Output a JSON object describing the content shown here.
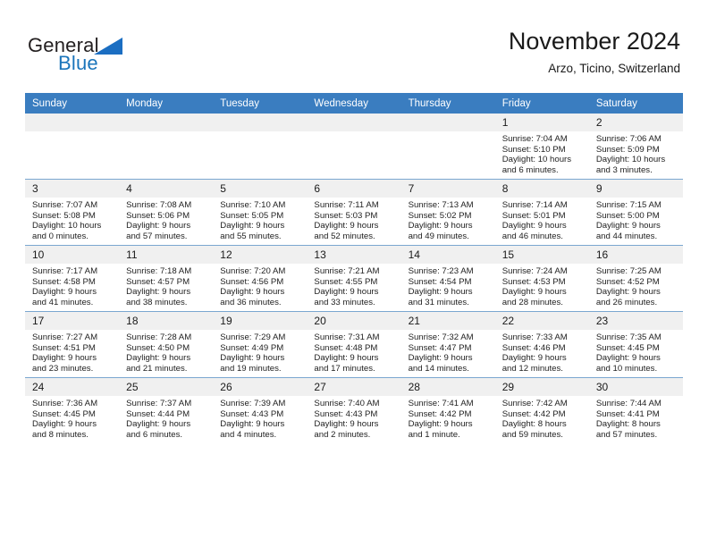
{
  "brand": {
    "text_primary": "General",
    "text_secondary": "Blue",
    "triangle_icon": "triangle-icon",
    "accent_color": "#1b6ec2"
  },
  "header": {
    "month_title": "November 2024",
    "location": "Arzo, Ticino, Switzerland"
  },
  "calendar": {
    "header_color": "#3a7dc0",
    "weekday_headers": [
      "Sunday",
      "Monday",
      "Tuesday",
      "Wednesday",
      "Thursday",
      "Friday",
      "Saturday"
    ],
    "weeks": [
      [
        {
          "day": "",
          "sunrise": "",
          "sunset": "",
          "daylight_line1": "",
          "daylight_line2": "",
          "empty": true
        },
        {
          "day": "",
          "sunrise": "",
          "sunset": "",
          "daylight_line1": "",
          "daylight_line2": "",
          "empty": true
        },
        {
          "day": "",
          "sunrise": "",
          "sunset": "",
          "daylight_line1": "",
          "daylight_line2": "",
          "empty": true
        },
        {
          "day": "",
          "sunrise": "",
          "sunset": "",
          "daylight_line1": "",
          "daylight_line2": "",
          "empty": true
        },
        {
          "day": "",
          "sunrise": "",
          "sunset": "",
          "daylight_line1": "",
          "daylight_line2": "",
          "empty": true
        },
        {
          "day": "1",
          "sunrise": "Sunrise: 7:04 AM",
          "sunset": "Sunset: 5:10 PM",
          "daylight_line1": "Daylight: 10 hours",
          "daylight_line2": "and 6 minutes.",
          "empty": false
        },
        {
          "day": "2",
          "sunrise": "Sunrise: 7:06 AM",
          "sunset": "Sunset: 5:09 PM",
          "daylight_line1": "Daylight: 10 hours",
          "daylight_line2": "and 3 minutes.",
          "empty": false
        }
      ],
      [
        {
          "day": "3",
          "sunrise": "Sunrise: 7:07 AM",
          "sunset": "Sunset: 5:08 PM",
          "daylight_line1": "Daylight: 10 hours",
          "daylight_line2": "and 0 minutes.",
          "empty": false
        },
        {
          "day": "4",
          "sunrise": "Sunrise: 7:08 AM",
          "sunset": "Sunset: 5:06 PM",
          "daylight_line1": "Daylight: 9 hours",
          "daylight_line2": "and 57 minutes.",
          "empty": false
        },
        {
          "day": "5",
          "sunrise": "Sunrise: 7:10 AM",
          "sunset": "Sunset: 5:05 PM",
          "daylight_line1": "Daylight: 9 hours",
          "daylight_line2": "and 55 minutes.",
          "empty": false
        },
        {
          "day": "6",
          "sunrise": "Sunrise: 7:11 AM",
          "sunset": "Sunset: 5:03 PM",
          "daylight_line1": "Daylight: 9 hours",
          "daylight_line2": "and 52 minutes.",
          "empty": false
        },
        {
          "day": "7",
          "sunrise": "Sunrise: 7:13 AM",
          "sunset": "Sunset: 5:02 PM",
          "daylight_line1": "Daylight: 9 hours",
          "daylight_line2": "and 49 minutes.",
          "empty": false
        },
        {
          "day": "8",
          "sunrise": "Sunrise: 7:14 AM",
          "sunset": "Sunset: 5:01 PM",
          "daylight_line1": "Daylight: 9 hours",
          "daylight_line2": "and 46 minutes.",
          "empty": false
        },
        {
          "day": "9",
          "sunrise": "Sunrise: 7:15 AM",
          "sunset": "Sunset: 5:00 PM",
          "daylight_line1": "Daylight: 9 hours",
          "daylight_line2": "and 44 minutes.",
          "empty": false
        }
      ],
      [
        {
          "day": "10",
          "sunrise": "Sunrise: 7:17 AM",
          "sunset": "Sunset: 4:58 PM",
          "daylight_line1": "Daylight: 9 hours",
          "daylight_line2": "and 41 minutes.",
          "empty": false
        },
        {
          "day": "11",
          "sunrise": "Sunrise: 7:18 AM",
          "sunset": "Sunset: 4:57 PM",
          "daylight_line1": "Daylight: 9 hours",
          "daylight_line2": "and 38 minutes.",
          "empty": false
        },
        {
          "day": "12",
          "sunrise": "Sunrise: 7:20 AM",
          "sunset": "Sunset: 4:56 PM",
          "daylight_line1": "Daylight: 9 hours",
          "daylight_line2": "and 36 minutes.",
          "empty": false
        },
        {
          "day": "13",
          "sunrise": "Sunrise: 7:21 AM",
          "sunset": "Sunset: 4:55 PM",
          "daylight_line1": "Daylight: 9 hours",
          "daylight_line2": "and 33 minutes.",
          "empty": false
        },
        {
          "day": "14",
          "sunrise": "Sunrise: 7:23 AM",
          "sunset": "Sunset: 4:54 PM",
          "daylight_line1": "Daylight: 9 hours",
          "daylight_line2": "and 31 minutes.",
          "empty": false
        },
        {
          "day": "15",
          "sunrise": "Sunrise: 7:24 AM",
          "sunset": "Sunset: 4:53 PM",
          "daylight_line1": "Daylight: 9 hours",
          "daylight_line2": "and 28 minutes.",
          "empty": false
        },
        {
          "day": "16",
          "sunrise": "Sunrise: 7:25 AM",
          "sunset": "Sunset: 4:52 PM",
          "daylight_line1": "Daylight: 9 hours",
          "daylight_line2": "and 26 minutes.",
          "empty": false
        }
      ],
      [
        {
          "day": "17",
          "sunrise": "Sunrise: 7:27 AM",
          "sunset": "Sunset: 4:51 PM",
          "daylight_line1": "Daylight: 9 hours",
          "daylight_line2": "and 23 minutes.",
          "empty": false
        },
        {
          "day": "18",
          "sunrise": "Sunrise: 7:28 AM",
          "sunset": "Sunset: 4:50 PM",
          "daylight_line1": "Daylight: 9 hours",
          "daylight_line2": "and 21 minutes.",
          "empty": false
        },
        {
          "day": "19",
          "sunrise": "Sunrise: 7:29 AM",
          "sunset": "Sunset: 4:49 PM",
          "daylight_line1": "Daylight: 9 hours",
          "daylight_line2": "and 19 minutes.",
          "empty": false
        },
        {
          "day": "20",
          "sunrise": "Sunrise: 7:31 AM",
          "sunset": "Sunset: 4:48 PM",
          "daylight_line1": "Daylight: 9 hours",
          "daylight_line2": "and 17 minutes.",
          "empty": false
        },
        {
          "day": "21",
          "sunrise": "Sunrise: 7:32 AM",
          "sunset": "Sunset: 4:47 PM",
          "daylight_line1": "Daylight: 9 hours",
          "daylight_line2": "and 14 minutes.",
          "empty": false
        },
        {
          "day": "22",
          "sunrise": "Sunrise: 7:33 AM",
          "sunset": "Sunset: 4:46 PM",
          "daylight_line1": "Daylight: 9 hours",
          "daylight_line2": "and 12 minutes.",
          "empty": false
        },
        {
          "day": "23",
          "sunrise": "Sunrise: 7:35 AM",
          "sunset": "Sunset: 4:45 PM",
          "daylight_line1": "Daylight: 9 hours",
          "daylight_line2": "and 10 minutes.",
          "empty": false
        }
      ],
      [
        {
          "day": "24",
          "sunrise": "Sunrise: 7:36 AM",
          "sunset": "Sunset: 4:45 PM",
          "daylight_line1": "Daylight: 9 hours",
          "daylight_line2": "and 8 minutes.",
          "empty": false
        },
        {
          "day": "25",
          "sunrise": "Sunrise: 7:37 AM",
          "sunset": "Sunset: 4:44 PM",
          "daylight_line1": "Daylight: 9 hours",
          "daylight_line2": "and 6 minutes.",
          "empty": false
        },
        {
          "day": "26",
          "sunrise": "Sunrise: 7:39 AM",
          "sunset": "Sunset: 4:43 PM",
          "daylight_line1": "Daylight: 9 hours",
          "daylight_line2": "and 4 minutes.",
          "empty": false
        },
        {
          "day": "27",
          "sunrise": "Sunrise: 7:40 AM",
          "sunset": "Sunset: 4:43 PM",
          "daylight_line1": "Daylight: 9 hours",
          "daylight_line2": "and 2 minutes.",
          "empty": false
        },
        {
          "day": "28",
          "sunrise": "Sunrise: 7:41 AM",
          "sunset": "Sunset: 4:42 PM",
          "daylight_line1": "Daylight: 9 hours",
          "daylight_line2": "and 1 minute.",
          "empty": false
        },
        {
          "day": "29",
          "sunrise": "Sunrise: 7:42 AM",
          "sunset": "Sunset: 4:42 PM",
          "daylight_line1": "Daylight: 8 hours",
          "daylight_line2": "and 59 minutes.",
          "empty": false
        },
        {
          "day": "30",
          "sunrise": "Sunrise: 7:44 AM",
          "sunset": "Sunset: 4:41 PM",
          "daylight_line1": "Daylight: 8 hours",
          "daylight_line2": "and 57 minutes.",
          "empty": false
        }
      ]
    ]
  }
}
